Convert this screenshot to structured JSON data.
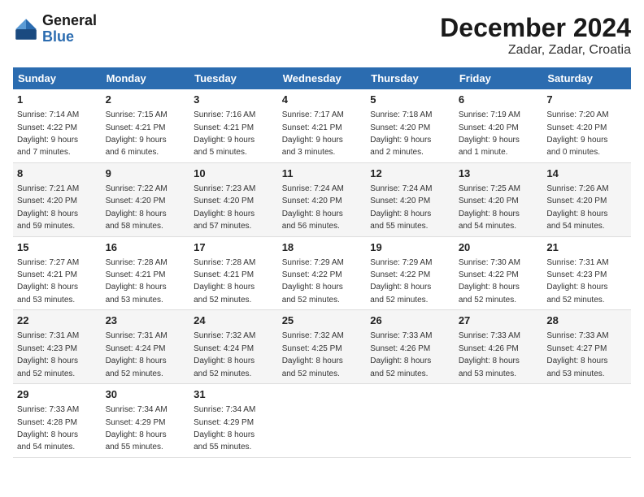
{
  "header": {
    "logo_line1": "General",
    "logo_line2": "Blue",
    "title": "December 2024",
    "subtitle": "Zadar, Zadar, Croatia"
  },
  "columns": [
    "Sunday",
    "Monday",
    "Tuesday",
    "Wednesday",
    "Thursday",
    "Friday",
    "Saturday"
  ],
  "weeks": [
    [
      {
        "day": "1",
        "info": "Sunrise: 7:14 AM\nSunset: 4:22 PM\nDaylight: 9 hours\nand 7 minutes."
      },
      {
        "day": "2",
        "info": "Sunrise: 7:15 AM\nSunset: 4:21 PM\nDaylight: 9 hours\nand 6 minutes."
      },
      {
        "day": "3",
        "info": "Sunrise: 7:16 AM\nSunset: 4:21 PM\nDaylight: 9 hours\nand 5 minutes."
      },
      {
        "day": "4",
        "info": "Sunrise: 7:17 AM\nSunset: 4:21 PM\nDaylight: 9 hours\nand 3 minutes."
      },
      {
        "day": "5",
        "info": "Sunrise: 7:18 AM\nSunset: 4:20 PM\nDaylight: 9 hours\nand 2 minutes."
      },
      {
        "day": "6",
        "info": "Sunrise: 7:19 AM\nSunset: 4:20 PM\nDaylight: 9 hours\nand 1 minute."
      },
      {
        "day": "7",
        "info": "Sunrise: 7:20 AM\nSunset: 4:20 PM\nDaylight: 9 hours\nand 0 minutes."
      }
    ],
    [
      {
        "day": "8",
        "info": "Sunrise: 7:21 AM\nSunset: 4:20 PM\nDaylight: 8 hours\nand 59 minutes."
      },
      {
        "day": "9",
        "info": "Sunrise: 7:22 AM\nSunset: 4:20 PM\nDaylight: 8 hours\nand 58 minutes."
      },
      {
        "day": "10",
        "info": "Sunrise: 7:23 AM\nSunset: 4:20 PM\nDaylight: 8 hours\nand 57 minutes."
      },
      {
        "day": "11",
        "info": "Sunrise: 7:24 AM\nSunset: 4:20 PM\nDaylight: 8 hours\nand 56 minutes."
      },
      {
        "day": "12",
        "info": "Sunrise: 7:24 AM\nSunset: 4:20 PM\nDaylight: 8 hours\nand 55 minutes."
      },
      {
        "day": "13",
        "info": "Sunrise: 7:25 AM\nSunset: 4:20 PM\nDaylight: 8 hours\nand 54 minutes."
      },
      {
        "day": "14",
        "info": "Sunrise: 7:26 AM\nSunset: 4:20 PM\nDaylight: 8 hours\nand 54 minutes."
      }
    ],
    [
      {
        "day": "15",
        "info": "Sunrise: 7:27 AM\nSunset: 4:21 PM\nDaylight: 8 hours\nand 53 minutes."
      },
      {
        "day": "16",
        "info": "Sunrise: 7:28 AM\nSunset: 4:21 PM\nDaylight: 8 hours\nand 53 minutes."
      },
      {
        "day": "17",
        "info": "Sunrise: 7:28 AM\nSunset: 4:21 PM\nDaylight: 8 hours\nand 52 minutes."
      },
      {
        "day": "18",
        "info": "Sunrise: 7:29 AM\nSunset: 4:22 PM\nDaylight: 8 hours\nand 52 minutes."
      },
      {
        "day": "19",
        "info": "Sunrise: 7:29 AM\nSunset: 4:22 PM\nDaylight: 8 hours\nand 52 minutes."
      },
      {
        "day": "20",
        "info": "Sunrise: 7:30 AM\nSunset: 4:22 PM\nDaylight: 8 hours\nand 52 minutes."
      },
      {
        "day": "21",
        "info": "Sunrise: 7:31 AM\nSunset: 4:23 PM\nDaylight: 8 hours\nand 52 minutes."
      }
    ],
    [
      {
        "day": "22",
        "info": "Sunrise: 7:31 AM\nSunset: 4:23 PM\nDaylight: 8 hours\nand 52 minutes."
      },
      {
        "day": "23",
        "info": "Sunrise: 7:31 AM\nSunset: 4:24 PM\nDaylight: 8 hours\nand 52 minutes."
      },
      {
        "day": "24",
        "info": "Sunrise: 7:32 AM\nSunset: 4:24 PM\nDaylight: 8 hours\nand 52 minutes."
      },
      {
        "day": "25",
        "info": "Sunrise: 7:32 AM\nSunset: 4:25 PM\nDaylight: 8 hours\nand 52 minutes."
      },
      {
        "day": "26",
        "info": "Sunrise: 7:33 AM\nSunset: 4:26 PM\nDaylight: 8 hours\nand 52 minutes."
      },
      {
        "day": "27",
        "info": "Sunrise: 7:33 AM\nSunset: 4:26 PM\nDaylight: 8 hours\nand 53 minutes."
      },
      {
        "day": "28",
        "info": "Sunrise: 7:33 AM\nSunset: 4:27 PM\nDaylight: 8 hours\nand 53 minutes."
      }
    ],
    [
      {
        "day": "29",
        "info": "Sunrise: 7:33 AM\nSunset: 4:28 PM\nDaylight: 8 hours\nand 54 minutes."
      },
      {
        "day": "30",
        "info": "Sunrise: 7:34 AM\nSunset: 4:29 PM\nDaylight: 8 hours\nand 55 minutes."
      },
      {
        "day": "31",
        "info": "Sunrise: 7:34 AM\nSunset: 4:29 PM\nDaylight: 8 hours\nand 55 minutes."
      },
      null,
      null,
      null,
      null
    ]
  ]
}
